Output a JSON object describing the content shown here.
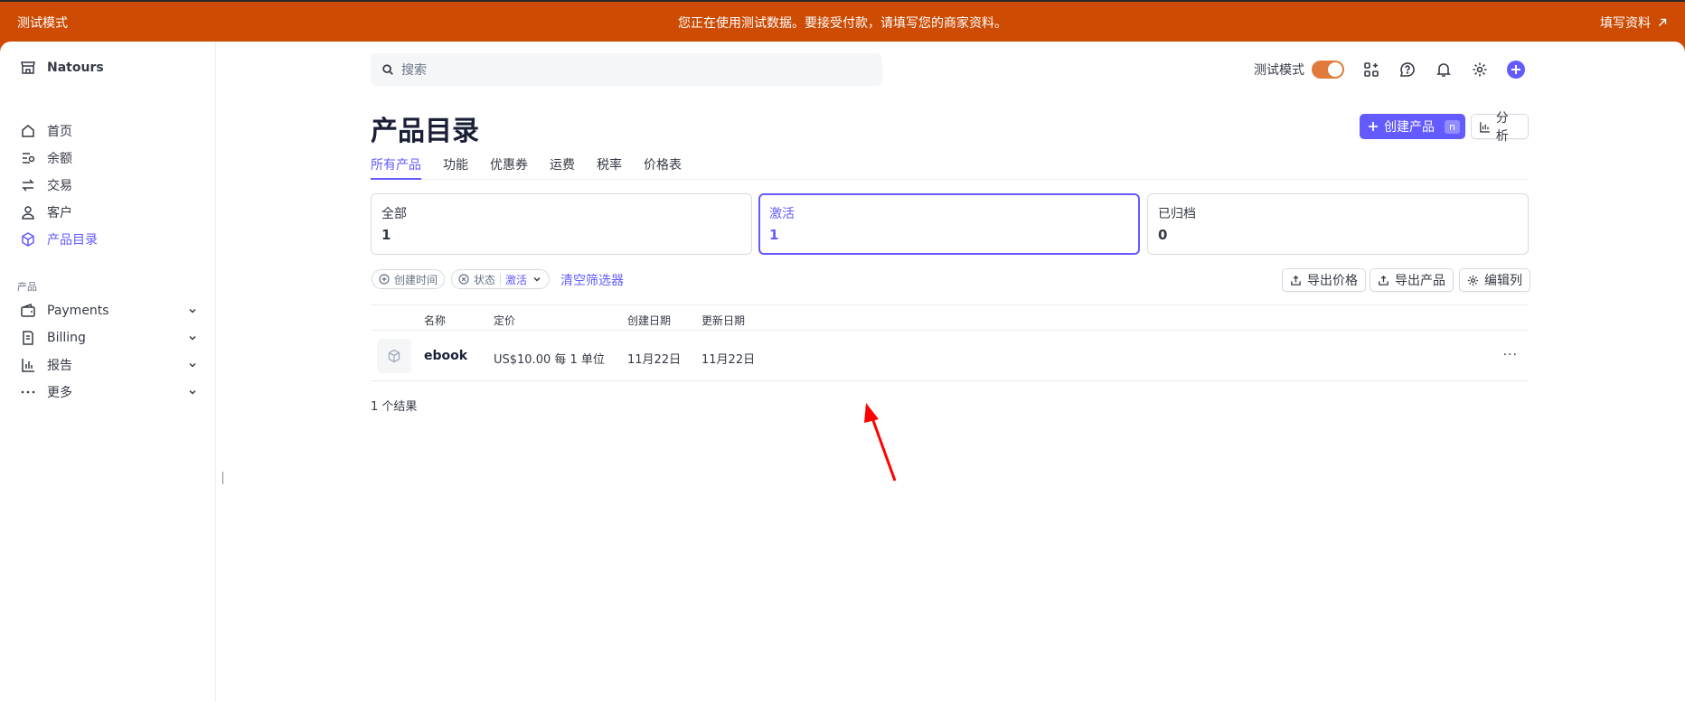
{
  "banner": {
    "mode_label": "测试模式",
    "message": "您正在使用测试数据。要接受付款，请填写您的商家资料。",
    "action_label": "填写资料"
  },
  "sidebar": {
    "brand": "Natours",
    "items": [
      {
        "label": "首页",
        "icon": "home-icon"
      },
      {
        "label": "余额",
        "icon": "balance-icon"
      },
      {
        "label": "交易",
        "icon": "transactions-icon"
      },
      {
        "label": "客户",
        "icon": "customer-icon"
      },
      {
        "label": "产品目录",
        "icon": "product-box-icon",
        "active": true
      }
    ],
    "section_label": "产品",
    "products": [
      {
        "label": "Payments",
        "icon": "wallet-icon"
      },
      {
        "label": "Billing",
        "icon": "billing-icon"
      },
      {
        "label": "报告",
        "icon": "bar-chart-icon"
      },
      {
        "label": "更多",
        "icon": "more-dots-icon"
      }
    ]
  },
  "topbar": {
    "search_placeholder": "搜索",
    "test_mode_label": "测试模式"
  },
  "page": {
    "title": "产品目录",
    "create_button": "创建产品",
    "create_shortcut": "n",
    "analytics_button": "分析"
  },
  "tabs": [
    "所有产品",
    "功能",
    "优惠券",
    "运费",
    "税率",
    "价格表"
  ],
  "status_cards": [
    {
      "label": "全部",
      "count": "1"
    },
    {
      "label": "激活",
      "count": "1",
      "active": true
    },
    {
      "label": "已归档",
      "count": "0"
    }
  ],
  "filters": {
    "created_chip": "创建时间",
    "status_chip": "状态",
    "status_value": "激活",
    "clear": "清空筛选器"
  },
  "actions": {
    "export_prices": "导出价格",
    "export_products": "导出产品",
    "edit_columns": "编辑列"
  },
  "table": {
    "headers": [
      "名称",
      "定价",
      "创建日期",
      "更新日期"
    ],
    "rows": [
      {
        "name": "ebook",
        "price": "US$10.00 每 1 单位",
        "created": "11月22日",
        "updated": "11月22日"
      }
    ],
    "result_count": "1 个结果"
  },
  "colors": {
    "banner": "#cd4b03",
    "accent": "#635bff",
    "annotation_arrow": "#ff0000"
  }
}
